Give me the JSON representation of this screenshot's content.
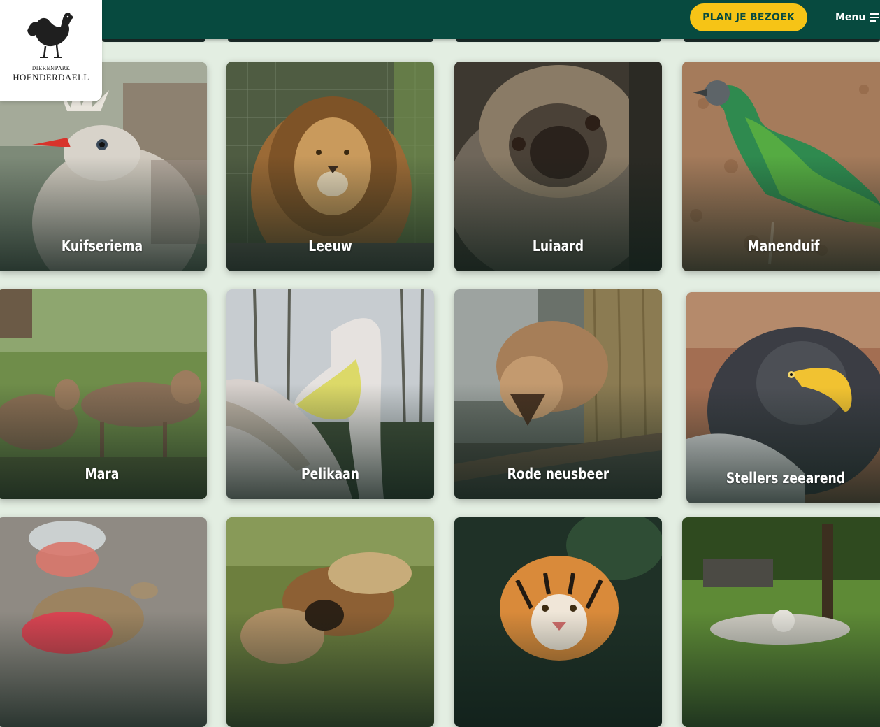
{
  "header": {
    "logo_top": "DIERENPARK",
    "logo_name": "HOENDERDAELL",
    "cta_label": "PLAN JE BEZOEK",
    "menu_label": "Menu"
  },
  "animals": [
    {
      "name": "Kuifseriema"
    },
    {
      "name": "Leeuw"
    },
    {
      "name": "Luiaard"
    },
    {
      "name": "Manenduif"
    },
    {
      "name": "Mara"
    },
    {
      "name": "Pelikaan"
    },
    {
      "name": "Rode neusbeer"
    },
    {
      "name": "Stellers zeearend"
    },
    {
      "name": ""
    },
    {
      "name": ""
    },
    {
      "name": ""
    },
    {
      "name": ""
    }
  ],
  "colors": {
    "header": "#074a3f",
    "accent": "#f6c416",
    "page_background": "#e3eee2"
  }
}
